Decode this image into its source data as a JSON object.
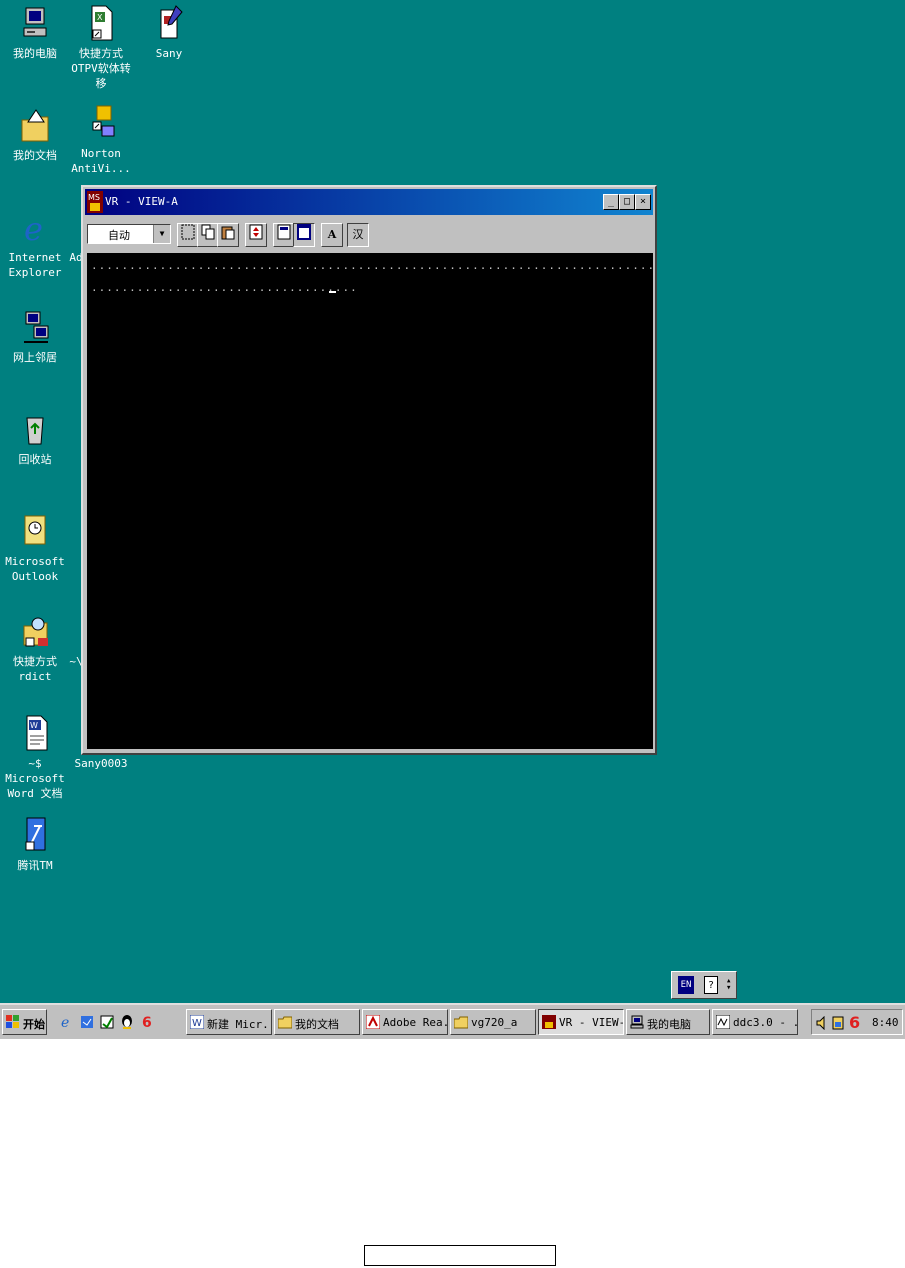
{
  "desktop": {
    "icons": [
      {
        "label": "我的电脑"
      },
      {
        "label": "快捷方式\nOTPV软体转移"
      },
      {
        "label": "Sany"
      },
      {
        "label": "我的文档"
      },
      {
        "label": "Norton\nAntiVi..."
      },
      {
        "label": "Internet\nExplorer"
      },
      {
        "label": "Ad"
      },
      {
        "label": "网上邻居"
      },
      {
        "label": "回收站"
      },
      {
        "label": "Microsoft\nOutlook"
      },
      {
        "label": "快捷方式\nrdict"
      },
      {
        "label": "~\\"
      },
      {
        "label": "~$ Microsoft\nWord 文档"
      },
      {
        "label": "Sany0003"
      },
      {
        "label": "腾讯TM"
      }
    ]
  },
  "window": {
    "title": "VR - VIEW-A",
    "app_icon_text": "MS",
    "minimize": "_",
    "maximize": "□",
    "close": "×",
    "toolbar": {
      "font_combo_value": "自动",
      "font_a": "A",
      "han": "汉"
    },
    "terminal": {
      "line1": "..............................................................................................................",
      "line2": "..................................."
    }
  },
  "langbar": {
    "lang": "EN",
    "help": "?"
  },
  "taskbar": {
    "start_label": "开始",
    "tasks": [
      {
        "label": "新建 Micr..."
      },
      {
        "label": "我的文档"
      },
      {
        "label": "Adobe Rea..."
      },
      {
        "label": "vg720_a"
      },
      {
        "label": "VR - VIEW-A"
      },
      {
        "label": "我的电脑"
      },
      {
        "label": "ddc3.0 - ..."
      }
    ],
    "clock": "8:40"
  }
}
